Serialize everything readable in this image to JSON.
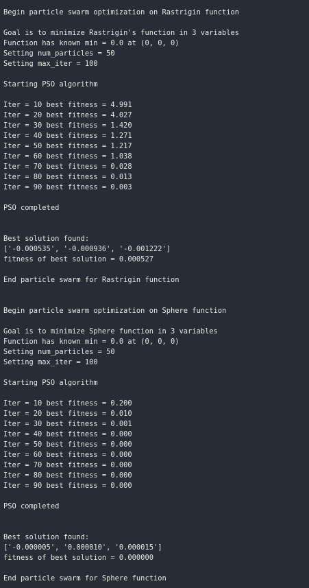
{
  "console": {
    "lines": [
      "Begin particle swarm optimization on Rastrigin function",
      "",
      "Goal is to minimize Rastrigin's function in 3 variables",
      "Function has known min = 0.0 at (0, 0, 0)",
      "Setting num_particles = 50",
      "Setting max_iter = 100",
      "",
      "Starting PSO algorithm",
      "",
      "Iter = 10 best fitness = 4.991",
      "Iter = 20 best fitness = 4.027",
      "Iter = 30 best fitness = 1.420",
      "Iter = 40 best fitness = 1.271",
      "Iter = 50 best fitness = 1.217",
      "Iter = 60 best fitness = 1.038",
      "Iter = 70 best fitness = 0.028",
      "Iter = 80 best fitness = 0.013",
      "Iter = 90 best fitness = 0.003",
      "",
      "PSO completed",
      "",
      "",
      "Best solution found:",
      "['-0.000535', '-0.000936', '-0.001222']",
      "fitness of best solution = 0.000527",
      "",
      "End particle swarm for Rastrigin function",
      "",
      "",
      "Begin particle swarm optimization on Sphere function",
      "",
      "Goal is to minimize Sphere function in 3 variables",
      "Function has known min = 0.0 at (0, 0, 0)",
      "Setting num_particles = 50",
      "Setting max_iter = 100",
      "",
      "Starting PSO algorithm",
      "",
      "Iter = 10 best fitness = 0.200",
      "Iter = 20 best fitness = 0.010",
      "Iter = 30 best fitness = 0.001",
      "Iter = 40 best fitness = 0.000",
      "Iter = 50 best fitness = 0.000",
      "Iter = 60 best fitness = 0.000",
      "Iter = 70 best fitness = 0.000",
      "Iter = 80 best fitness = 0.000",
      "Iter = 90 best fitness = 0.000",
      "",
      "PSO completed",
      "",
      "",
      "Best solution found:",
      "['-0.000005', '0.000010', '0.000015']",
      "fitness of best solution = 0.000000",
      "",
      "End particle swarm for Sphere function"
    ]
  },
  "colors": {
    "background": "#282c34",
    "text": "#e6e6e6"
  }
}
